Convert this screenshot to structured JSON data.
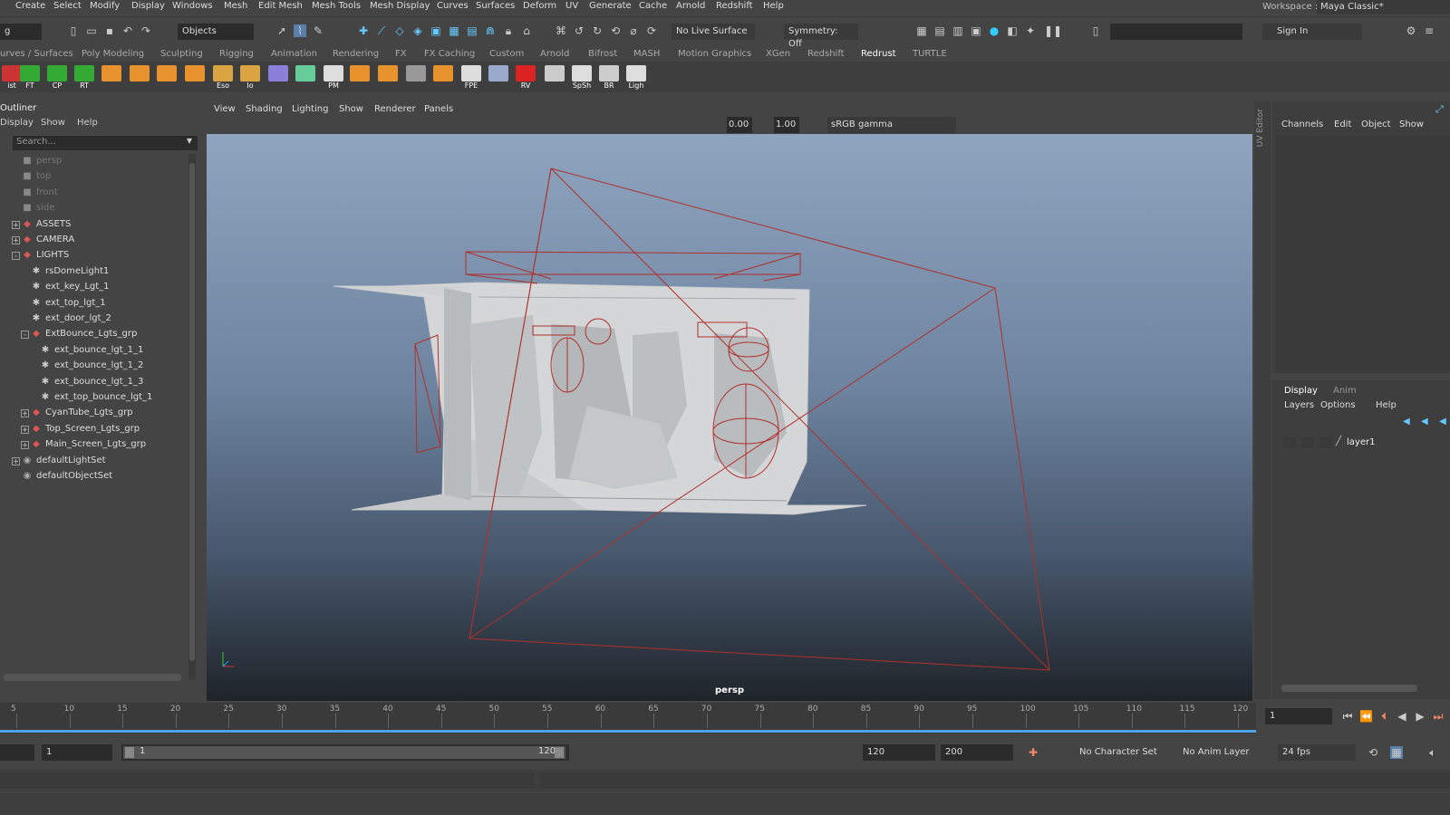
{
  "menu": [
    "Create",
    "Select",
    "Modify",
    "Display",
    "Windows",
    "Mesh",
    "Edit Mesh",
    "Mesh Tools",
    "Mesh Display",
    "Curves",
    "Surfaces",
    "Deform",
    "UV",
    "Generate",
    "Cache",
    "Arnold",
    "Redshift",
    "Help"
  ],
  "workspace": {
    "label": "Workspace :",
    "value": "Maya Classic*"
  },
  "status": {
    "mode_partial": "g",
    "selection_mode": "Objects",
    "live_surface": "No Live Surface",
    "symmetry": "Symmetry: Off",
    "sign_in": "Sign In"
  },
  "shelf_tabs": [
    "urves / Surfaces",
    "Poly Modeling",
    "Sculpting",
    "Rigging",
    "Animation",
    "Rendering",
    "FX",
    "FX Caching",
    "Custom",
    "Arnold",
    "Bifrost",
    "MASH",
    "Motion Graphics",
    "XGen",
    "Redshift",
    "Redrust",
    "TURTLE"
  ],
  "shelf_active": "Redrust",
  "shelf_icons": [
    {
      "label": "ist",
      "icon": "list-icon",
      "color": "#c33"
    },
    {
      "label": "FT",
      "icon": "axis-icon",
      "color": "#3a3"
    },
    {
      "label": "CP",
      "icon": "axis-icon",
      "color": "#3a3"
    },
    {
      "label": "RT",
      "icon": "axis-icon",
      "color": "#3a3"
    },
    {
      "label": "",
      "icon": "sphere-icon",
      "color": "#e8922e"
    },
    {
      "label": "",
      "icon": "cube-icon",
      "color": "#e8922e"
    },
    {
      "label": "",
      "icon": "cylinder-icon",
      "color": "#e8922e"
    },
    {
      "label": "",
      "icon": "diamond-icon",
      "color": "#e8922e"
    },
    {
      "label": "Eso",
      "icon": "folder-icon",
      "color": "#d9a441"
    },
    {
      "label": "Io",
      "icon": "folder-icon",
      "color": "#d9a441"
    },
    {
      "label": "",
      "icon": "lattice-icon",
      "color": "#8a7fd9"
    },
    {
      "label": "",
      "icon": "grid-icon",
      "color": "#6c9"
    },
    {
      "label": "PM",
      "icon": "window-icon",
      "color": "#ddd"
    },
    {
      "label": "",
      "icon": "bars-icon",
      "color": "#e8922e"
    },
    {
      "label": "",
      "icon": "bars-icon",
      "color": "#e8922e"
    },
    {
      "label": "",
      "icon": "table-icon",
      "color": "#999"
    },
    {
      "label": "",
      "icon": "stack-icon",
      "color": "#e8922e"
    },
    {
      "label": "FPE",
      "icon": "window-icon",
      "color": "#ddd"
    },
    {
      "label": "",
      "icon": "render-icon",
      "color": "#9ac"
    },
    {
      "label": "RV",
      "icon": "redshift-cube-icon",
      "color": "#d22"
    },
    {
      "label": "",
      "icon": "pencil-icon",
      "color": "#ccc"
    },
    {
      "label": "SpSh",
      "icon": "window-icon",
      "color": "#ddd"
    },
    {
      "label": "BR",
      "icon": "film-icon",
      "color": "#ccc"
    },
    {
      "label": "Ligh",
      "icon": "window-icon",
      "color": "#ddd"
    }
  ],
  "outliner": {
    "title": "Outliner",
    "menu": [
      "Display",
      "Show",
      "Help"
    ],
    "search_placeholder": "Search...",
    "items": [
      {
        "label": "persp",
        "depth": 0,
        "icon": "camera-icon",
        "dim": true,
        "exp": ""
      },
      {
        "label": "top",
        "depth": 0,
        "icon": "camera-icon",
        "dim": true,
        "exp": ""
      },
      {
        "label": "front",
        "depth": 0,
        "icon": "camera-icon",
        "dim": true,
        "exp": ""
      },
      {
        "label": "side",
        "depth": 0,
        "icon": "camera-icon",
        "dim": true,
        "exp": ""
      },
      {
        "label": "ASSETS",
        "depth": 0,
        "icon": "group-icon",
        "dim": false,
        "exp": "+"
      },
      {
        "label": "CAMERA",
        "depth": 0,
        "icon": "group-icon",
        "dim": false,
        "exp": "+"
      },
      {
        "label": "LIGHTS",
        "depth": 0,
        "icon": "group-icon",
        "dim": false,
        "exp": "-"
      },
      {
        "label": "rsDomeLight1",
        "depth": 1,
        "icon": "light-icon",
        "dim": false,
        "exp": ""
      },
      {
        "label": "ext_key_Lgt_1",
        "depth": 1,
        "icon": "light-icon",
        "dim": false,
        "exp": ""
      },
      {
        "label": "ext_top_lgt_1",
        "depth": 1,
        "icon": "light-icon",
        "dim": false,
        "exp": ""
      },
      {
        "label": "ext_door_lgt_2",
        "depth": 1,
        "icon": "light-icon",
        "dim": false,
        "exp": ""
      },
      {
        "label": "ExtBounce_Lgts_grp",
        "depth": 1,
        "icon": "group-icon",
        "dim": false,
        "exp": "-"
      },
      {
        "label": "ext_bounce_lgt_1_1",
        "depth": 2,
        "icon": "light-icon",
        "dim": false,
        "exp": ""
      },
      {
        "label": "ext_bounce_lgt_1_2",
        "depth": 2,
        "icon": "light-icon",
        "dim": false,
        "exp": ""
      },
      {
        "label": "ext_bounce_lgt_1_3",
        "depth": 2,
        "icon": "light-icon",
        "dim": false,
        "exp": ""
      },
      {
        "label": "ext_top_bounce_lgt_1",
        "depth": 2,
        "icon": "light-icon",
        "dim": false,
        "exp": ""
      },
      {
        "label": "CyanTube_Lgts_grp",
        "depth": 1,
        "icon": "group-icon",
        "dim": false,
        "exp": "+"
      },
      {
        "label": "Top_Screen_Lgts_grp",
        "depth": 1,
        "icon": "group-icon",
        "dim": false,
        "exp": "+"
      },
      {
        "label": "Main_Screen_Lgts_grp",
        "depth": 1,
        "icon": "group-icon",
        "dim": false,
        "exp": "+"
      },
      {
        "label": "defaultLightSet",
        "depth": 0,
        "icon": "set-icon",
        "dim": false,
        "exp": "+"
      },
      {
        "label": "defaultObjectSet",
        "depth": 0,
        "icon": "set-icon",
        "dim": false,
        "exp": ""
      }
    ]
  },
  "viewport": {
    "menu": [
      "View",
      "Shading",
      "Lighting",
      "Show",
      "Renderer",
      "Panels"
    ],
    "exposure": "0.00",
    "gamma": "1.00",
    "color_space": "sRGB gamma",
    "camera_label": "persp"
  },
  "right_panel": {
    "uv_editor": "UV Editor",
    "channel_menu": [
      "Channels",
      "Edit",
      "Object",
      "Show"
    ],
    "layer_tabs": [
      "Display",
      "Anim"
    ],
    "layer_menu": [
      "Layers",
      "Options",
      "Help"
    ],
    "layer_name": "layer1"
  },
  "timeline": {
    "ticks": [
      "5",
      "10",
      "15",
      "20",
      "25",
      "30",
      "35",
      "40",
      "45",
      "50",
      "55",
      "60",
      "65",
      "70",
      "75",
      "80",
      "85",
      "90",
      "95",
      "100",
      "105",
      "110",
      "115",
      "120"
    ],
    "current_frame": "1"
  },
  "range": {
    "start": "1",
    "range_start": "1",
    "range_end": "120",
    "end": "120",
    "anim_end": "200",
    "character_set": "No Character Set",
    "anim_layer": "No Anim Layer",
    "fps": "24 fps"
  },
  "colors": {
    "accent": "#4ca3e5",
    "light_wire": "#b0302a"
  }
}
